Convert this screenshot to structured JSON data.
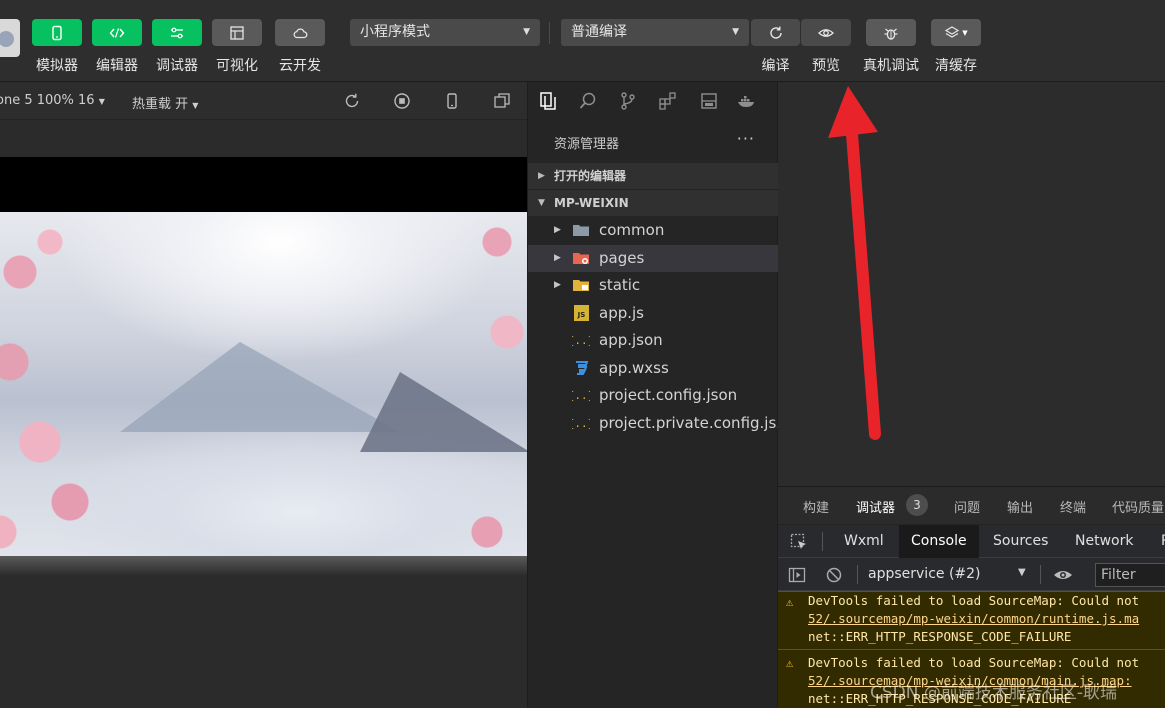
{
  "toolbar": {
    "buttons": [
      {
        "label": "模拟器",
        "icon": "phone-icon"
      },
      {
        "label": "编辑器",
        "icon": "code-icon"
      },
      {
        "label": "调试器",
        "icon": "debug-sliders-icon"
      },
      {
        "label": "可视化",
        "icon": "layout-icon"
      },
      {
        "label": "云开发",
        "icon": "cloud-icon"
      }
    ],
    "mode_select": "小程序模式",
    "compile_select": "普通编译",
    "actions": [
      {
        "label": "编译",
        "icon": "refresh-icon"
      },
      {
        "label": "预览",
        "icon": "eye-icon"
      },
      {
        "label": "真机调试",
        "icon": "bug-icon"
      },
      {
        "label": "清缓存",
        "icon": "layers-icon"
      }
    ]
  },
  "simulator": {
    "device": "one 5 100% 16",
    "hot_reload": "热重载 开"
  },
  "explorer": {
    "title": "资源管理器",
    "more": "···",
    "sections": {
      "open_editors": "打开的编辑器",
      "project": "MP-WEIXIN"
    },
    "items": [
      {
        "name": "common",
        "type": "folder",
        "icon": "folder-icon"
      },
      {
        "name": "pages",
        "type": "folder",
        "icon": "pages-folder-icon"
      },
      {
        "name": "static",
        "type": "folder",
        "icon": "static-folder-icon"
      },
      {
        "name": "app.js",
        "type": "file",
        "icon": "js-file-icon"
      },
      {
        "name": "app.json",
        "type": "file",
        "icon": "json-file-icon"
      },
      {
        "name": "app.wxss",
        "type": "file",
        "icon": "css-file-icon"
      },
      {
        "name": "project.config.json",
        "type": "file",
        "icon": "json-file-icon"
      },
      {
        "name": "project.private.config.js...",
        "type": "file",
        "icon": "json-file-icon"
      }
    ]
  },
  "devtools": {
    "tabs": [
      "构建",
      "调试器",
      "问题",
      "输出",
      "终端",
      "代码质量"
    ],
    "badge": "3",
    "panel_tabs": [
      "Wxml",
      "Console",
      "Sources",
      "Network",
      "P"
    ],
    "context": "appservice (#2)",
    "filter_placeholder": "Filter",
    "messages": [
      {
        "line1": "DevTools failed to load SourceMap: Could not",
        "line2": "52/.sourcemap/mp-weixin/common/runtime.js.ma",
        "line3": "net::ERR_HTTP_RESPONSE_CODE_FAILURE"
      },
      {
        "line1": "DevTools failed to load SourceMap: Could not",
        "line2": "52/.sourcemap/mp-weixin/common/main.js.map:",
        "line3": "net::ERR_HTTP_RESPONSE_CODE_FAILURE"
      }
    ]
  },
  "watermark": "CSDN @前端技术服务社区-耿瑞",
  "colors": {
    "accent_green": "#07c160",
    "annotation_red": "#e8242a",
    "warning_bg": "#332b00"
  }
}
